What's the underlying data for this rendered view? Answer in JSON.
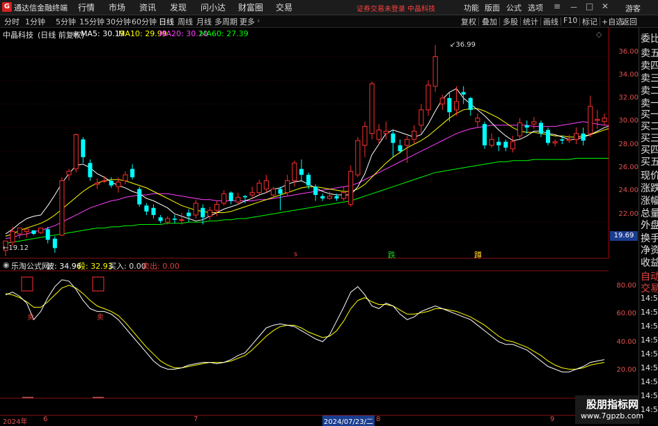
{
  "app": {
    "logo": "G",
    "title": "通达信金融终端"
  },
  "menu": [
    "行情",
    "市场",
    "资讯",
    "发现",
    "问小达",
    "财富圈",
    "交易"
  ],
  "notice": "证券交易未登录  中晶科技",
  "right_menu": [
    "功能",
    "版面",
    "公式",
    "选项"
  ],
  "window_buttons": [
    "≡",
    "－",
    "□",
    "✕"
  ],
  "user": "游客",
  "periods": [
    "分时",
    "1分钟",
    "5分钟",
    "15分钟",
    "30分钟",
    "60分钟",
    "日线",
    "周线",
    "月线",
    "多周期",
    "更多"
  ],
  "active_period": "日线",
  "tools": [
    "复权",
    "叠加",
    "多股",
    "统计",
    "画线",
    "F10",
    "标记",
    "+自选",
    "返回"
  ],
  "stock": {
    "name": "中晶科技",
    "mode": "(日线 前复权)"
  },
  "ma": {
    "ma5": {
      "label": "MA5: 30.19",
      "color": "#ffffff"
    },
    "ma10": {
      "label": "MA10: 29.99",
      "color": "#ffff00"
    },
    "ma20": {
      "label": "MA20: 30.20",
      "color": "#ff40ff"
    },
    "ma60": {
      "label": "MA60: 27.39",
      "color": "#00ff00"
    }
  },
  "price_axis": [
    "36.00",
    "34.00",
    "32.00",
    "30.00",
    "28.00",
    "26.00",
    "24.00",
    "22.00"
  ],
  "current_price": "19.69",
  "high_label": "36.99",
  "low_label": "19.12",
  "signals": {
    "s": "s",
    "die": "跌",
    "dun": "蹲"
  },
  "indicator": {
    "name": "乐淘公式网",
    "wave": "波: 34.96",
    "seg": "段: 32.93",
    "buy": "买入: 0.00",
    "sell": "卖出: 0.00",
    "sell_marker": "卖",
    "axis": [
      "80.00",
      "60.00",
      "40.00",
      "20.00"
    ]
  },
  "right_panel": [
    "委比",
    "卖五",
    "卖四",
    "卖三",
    "卖二",
    "卖一",
    "买一",
    "买二",
    "买三",
    "买四",
    "买五",
    "现价",
    "涨跌",
    "涨幅",
    "总量",
    "外盘",
    "换手",
    "净资",
    "收益",
    "自动",
    "交易",
    "14:56",
    "14:56",
    "14:56",
    "14:56",
    "14:56",
    "14:56",
    "14:56",
    "14:56",
    "14:56"
  ],
  "time_axis": {
    "start": "2024年",
    "m6": "6",
    "m7": "7",
    "cursor": "2024/07/23/二",
    "m8": "8",
    "m9": "9"
  },
  "watermark": {
    "line1": "股朋指标网",
    "line2": "www.7gpzb.com"
  },
  "chart_data": {
    "type": "candlestick",
    "ylim": [
      19,
      37.5
    ],
    "candles": [
      [
        19.6,
        20.4,
        19.12,
        19.8
      ],
      [
        20.3,
        21.2,
        20.0,
        21.6
      ],
      [
        21.0,
        21.5,
        20.6,
        21.0
      ],
      [
        21.2,
        21.4,
        20.7,
        21.4
      ],
      [
        21.3,
        21.0,
        20.9,
        21.3
      ],
      [
        21.1,
        21.5,
        21.0,
        21.2
      ],
      [
        21.4,
        20.5,
        20.2,
        21.6
      ],
      [
        20.6,
        19.8,
        19.4,
        20.8
      ],
      [
        20.9,
        25.5,
        20.8,
        25.8
      ],
      [
        26.0,
        26.3,
        25.5,
        26.5
      ],
      [
        26.5,
        29.4,
        26.2,
        29.5
      ],
      [
        29.0,
        27.5,
        27.0,
        29.2
      ],
      [
        27.0,
        25.8,
        25.5,
        27.3
      ],
      [
        25.2,
        25.3,
        24.8,
        25.7
      ],
      [
        25.5,
        25.5,
        25.3,
        25.9
      ],
      [
        25.5,
        25.1,
        24.9,
        25.8
      ],
      [
        25.0,
        25.4,
        24.5,
        25.8
      ],
      [
        25.5,
        26.0,
        25.2,
        26.3
      ],
      [
        26.5,
        25.8,
        25.6,
        26.9
      ],
      [
        24.8,
        23.5,
        23.3,
        25.0
      ],
      [
        23.4,
        22.9,
        22.6,
        23.6
      ],
      [
        23.2,
        22.6,
        22.3,
        23.5
      ],
      [
        22.4,
        22.1,
        21.9,
        22.6
      ],
      [
        22.0,
        22.3,
        21.8,
        22.5
      ],
      [
        22.3,
        22.2,
        21.9,
        22.6
      ],
      [
        22.2,
        22.2,
        21.8,
        22.8
      ],
      [
        22.8,
        22.5,
        22.0,
        23.1
      ],
      [
        22.6,
        23.6,
        22.3,
        23.9
      ],
      [
        23.2,
        22.4,
        21.8,
        23.5
      ],
      [
        22.5,
        23.0,
        22.2,
        23.3
      ],
      [
        23.0,
        23.5,
        22.5,
        23.8
      ],
      [
        23.6,
        24.4,
        23.4,
        24.7
      ],
      [
        24.5,
        23.8,
        23.5,
        24.6
      ],
      [
        23.7,
        24.1,
        23.5,
        24.5
      ],
      [
        24.2,
        24.1,
        23.6,
        24.3
      ],
      [
        24.3,
        24.5,
        24.0,
        25.0
      ],
      [
        24.5,
        25.3,
        24.2,
        25.6
      ],
      [
        24.8,
        25.5,
        24.5,
        26.0
      ],
      [
        24.3,
        24.8,
        24.0,
        25.0
      ],
      [
        24.8,
        24.4,
        23.0,
        25.0
      ],
      [
        24.5,
        25.5,
        24.2,
        26.0
      ],
      [
        25.5,
        27.0,
        25.0,
        27.2
      ],
      [
        26.5,
        26.0,
        25.5,
        27.3
      ],
      [
        26.0,
        25.1,
        24.8,
        26.2
      ],
      [
        25.0,
        24.3,
        23.8,
        25.2
      ],
      [
        24.2,
        24.0,
        23.8,
        24.4
      ],
      [
        24.0,
        24.2,
        23.9,
        24.6
      ],
      [
        24.2,
        24.0,
        23.8,
        24.4
      ],
      [
        24.0,
        24.5,
        23.8,
        25.0
      ],
      [
        23.5,
        26.3,
        23.3,
        26.8
      ],
      [
        26.0,
        28.9,
        25.8,
        29.2
      ],
      [
        28.5,
        30.1,
        27.5,
        30.5
      ],
      [
        29.5,
        33.7,
        29.0,
        33.9
      ],
      [
        29.0,
        29.8,
        28.6,
        30.3
      ],
      [
        29.5,
        29.7,
        29.0,
        30.5
      ],
      [
        29.5,
        28.7,
        27.5,
        29.8
      ],
      [
        28.5,
        28.0,
        27.8,
        29.0
      ],
      [
        28.5,
        29.0,
        27.0,
        29.3
      ],
      [
        29.0,
        29.7,
        28.6,
        30.2
      ],
      [
        30.2,
        31.5,
        29.5,
        32.0
      ],
      [
        31.5,
        33.6,
        31.0,
        34.0
      ],
      [
        33.5,
        36.0,
        33.0,
        36.99
      ],
      [
        32.0,
        32.5,
        31.5,
        32.8
      ],
      [
        32.5,
        31.3,
        30.5,
        33.0
      ],
      [
        31.5,
        32.2,
        31.0,
        33.5
      ],
      [
        33.0,
        32.8,
        32.0,
        33.5
      ],
      [
        32.5,
        31.5,
        31.0,
        32.6
      ],
      [
        30.5,
        30.8,
        30.0,
        31.2
      ],
      [
        30.3,
        28.5,
        28.2,
        30.5
      ],
      [
        28.5,
        29.0,
        28.3,
        29.5
      ],
      [
        28.8,
        28.5,
        28.0,
        29.2
      ],
      [
        28.8,
        28.3,
        28.0,
        29.0
      ],
      [
        28.2,
        28.8,
        27.9,
        29.3
      ],
      [
        29.3,
        30.4,
        29.0,
        30.8
      ],
      [
        30.2,
        30.0,
        29.5,
        30.6
      ],
      [
        30.3,
        30.5,
        29.9,
        30.9
      ],
      [
        30.4,
        29.5,
        29.2,
        30.6
      ],
      [
        29.8,
        28.7,
        28.5,
        30.0
      ],
      [
        28.7,
        28.8,
        28.4,
        29.0
      ],
      [
        29.0,
        28.9,
        28.6,
        29.3
      ],
      [
        28.9,
        29.0,
        28.7,
        29.4
      ],
      [
        29.0,
        29.5,
        28.6,
        30.0
      ],
      [
        29.5,
        28.9,
        28.5,
        30.0
      ],
      [
        29.5,
        31.8,
        29.2,
        32.7
      ],
      [
        30.6,
        30.7,
        29.9,
        31.5
      ],
      [
        30.5,
        30.8,
        30.2,
        31.2
      ]
    ],
    "ma5": [
      21.0,
      21.4,
      21.9,
      22.3,
      22.5,
      22.6,
      23.4,
      24.3,
      25.3,
      26.1,
      26.8,
      26.9,
      26.6,
      26.1,
      25.8,
      25.4,
      25.1,
      24.9,
      24.6,
      24.4,
      24.0,
      23.8,
      23.5,
      23.2,
      22.7,
      22.5,
      22.3,
      22.1,
      22.2,
      22.5,
      22.8,
      23.1,
      23.3,
      23.5,
      23.8,
      24.0,
      24.3,
      24.5,
      24.8,
      24.9,
      25.2,
      25.4,
      25.5,
      25.2,
      24.9,
      24.6,
      24.4,
      24.3,
      24.3,
      24.3,
      25.0,
      26.1,
      27.7,
      28.6,
      29.5,
      29.8,
      29.6,
      29.4,
      29.2,
      29.4,
      30.3,
      31.4,
      32.4,
      33.0,
      33.3,
      32.5,
      32.0,
      31.5,
      31.0,
      30.4,
      29.8,
      29.3,
      28.9,
      29.0,
      29.3,
      29.7,
      29.7,
      29.5,
      29.4,
      29.2,
      29.0,
      29.0,
      29.2,
      29.4,
      29.7,
      30.0,
      30.19
    ],
    "ma10": [
      20.8,
      21.0,
      21.3,
      21.5,
      21.7,
      21.9,
      22.2,
      22.6,
      23.1,
      23.6,
      24.1,
      24.6,
      25.0,
      25.3,
      25.5,
      25.6,
      25.6,
      25.5,
      25.3,
      25.1,
      24.9,
      24.6,
      24.3,
      24.0,
      23.7,
      23.4,
      23.2,
      23.0,
      22.9,
      22.8,
      22.8,
      22.8,
      22.9,
      23.1,
      23.3,
      23.5,
      23.7,
      23.9,
      24.1,
      24.3,
      24.5,
      24.7,
      24.9,
      25.0,
      25.0,
      24.9,
      24.8,
      24.7,
      24.6,
      24.6,
      24.8,
      25.2,
      25.8,
      26.4,
      27.0,
      27.5,
      27.9,
      28.3,
      28.6,
      28.9,
      29.3,
      29.8,
      30.3,
      30.8,
      31.2,
      31.5,
      31.6,
      31.6,
      31.4,
      31.1,
      30.8,
      30.4,
      30.0,
      29.7,
      29.6,
      29.6,
      29.5,
      29.4,
      29.3,
      29.3,
      29.2,
      29.2,
      29.3,
      29.4,
      29.6,
      29.8,
      29.99
    ],
    "ma20": [
      20.6,
      20.7,
      20.9,
      21.0,
      21.2,
      21.3,
      21.5,
      21.7,
      22.0,
      22.3,
      22.6,
      22.9,
      23.2,
      23.4,
      23.6,
      23.8,
      23.9,
      24.1,
      24.2,
      24.3,
      24.3,
      24.4,
      24.4,
      24.4,
      24.3,
      24.2,
      24.1,
      24.0,
      23.9,
      23.9,
      23.8,
      23.8,
      23.8,
      23.8,
      23.8,
      23.8,
      23.9,
      23.9,
      24.0,
      24.1,
      24.2,
      24.3,
      24.4,
      24.5,
      24.6,
      24.7,
      24.8,
      24.9,
      25.0,
      25.1,
      25.3,
      25.6,
      25.9,
      26.2,
      26.5,
      26.8,
      27.1,
      27.4,
      27.7,
      28.0,
      28.3,
      28.6,
      28.9,
      29.2,
      29.5,
      29.7,
      29.9,
      30.0,
      30.1,
      30.2,
      30.2,
      30.2,
      30.2,
      30.2,
      30.2,
      30.1,
      30.1,
      30.1,
      30.1,
      30.2,
      30.3,
      30.4,
      30.5,
      30.4,
      30.3,
      30.2,
      30.2
    ],
    "ma60": [
      20.2,
      20.3,
      20.4,
      20.5,
      20.6,
      20.7,
      20.8,
      20.9,
      21.0,
      21.1,
      21.2,
      21.3,
      21.4,
      21.5,
      21.5,
      21.6,
      21.6,
      21.7,
      21.7,
      21.8,
      21.8,
      21.8,
      21.8,
      21.9,
      21.9,
      21.9,
      22.0,
      22.0,
      22.0,
      22.1,
      22.1,
      22.2,
      22.2,
      22.3,
      22.3,
      22.4,
      22.5,
      22.6,
      22.7,
      22.8,
      22.9,
      23.0,
      23.1,
      23.2,
      23.3,
      23.4,
      23.5,
      23.6,
      23.7,
      23.8,
      24.0,
      24.2,
      24.4,
      24.6,
      24.8,
      25.0,
      25.2,
      25.4,
      25.6,
      25.8,
      26.0,
      26.2,
      26.3,
      26.4,
      26.5,
      26.6,
      26.7,
      26.8,
      26.9,
      27.0,
      27.1,
      27.1,
      27.2,
      27.2,
      27.2,
      27.3,
      27.3,
      27.3,
      27.3,
      27.3,
      27.3,
      27.4,
      27.4,
      27.4,
      27.4,
      27.4,
      27.39
    ],
    "ind_ylim": [
      10,
      100
    ],
    "wave": [
      84,
      86,
      83,
      78,
      66,
      72,
      82,
      90,
      95,
      94,
      88,
      80,
      74,
      72,
      72,
      70,
      66,
      60,
      54,
      48,
      42,
      36,
      32,
      30,
      30,
      31,
      33,
      34,
      35,
      35,
      34,
      35,
      37,
      40,
      42,
      48,
      54,
      60,
      62,
      63,
      62,
      61,
      58,
      55,
      52,
      50,
      55,
      65,
      75,
      86,
      90,
      84,
      76,
      74,
      78,
      76,
      70,
      66,
      68,
      72,
      74,
      76,
      74,
      72,
      70,
      68,
      66,
      62,
      58,
      54,
      50,
      48,
      48,
      46,
      44,
      40,
      36,
      32,
      30,
      28,
      28,
      30,
      32,
      35,
      36,
      37
    ],
    "seg": [
      85,
      84,
      82,
      79,
      75,
      75,
      79,
      84,
      89,
      91,
      89,
      85,
      80,
      76,
      74,
      72,
      69,
      64,
      58,
      52,
      46,
      41,
      36,
      33,
      31,
      31,
      32,
      33,
      34,
      35,
      35,
      35,
      36,
      38,
      40,
      44,
      49,
      54,
      58,
      61,
      62,
      62,
      60,
      57,
      55,
      53,
      54,
      58,
      65,
      74,
      80,
      82,
      79,
      77,
      77,
      76,
      73,
      70,
      70,
      71,
      72,
      74,
      74,
      73,
      72,
      70,
      68,
      65,
      62,
      58,
      54,
      51,
      50,
      48,
      46,
      43,
      40,
      36,
      33,
      31,
      30,
      30,
      31,
      33,
      34,
      35
    ]
  }
}
